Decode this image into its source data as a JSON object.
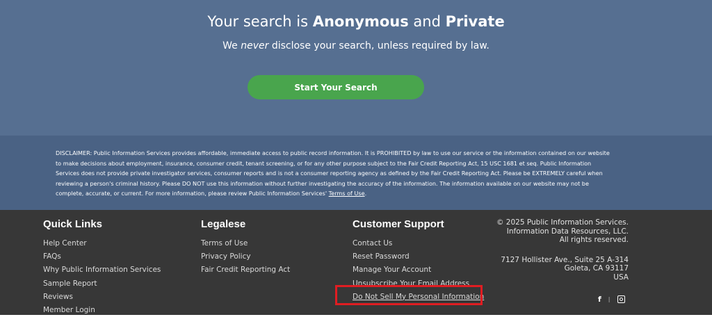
{
  "hero": {
    "title_prefix": "Your search is ",
    "title_bold1": "Anonymous",
    "title_mid": " and ",
    "title_bold2": "Private",
    "sub_prefix": "We ",
    "sub_em": "never",
    "sub_suffix": " disclose your search, unless required by law.",
    "cta_label": "Start Your Search"
  },
  "disclaimer": {
    "text": "DISCLAIMER: Public Information Services provides affordable, immediate access to public record information. It is PROHIBITED by law to use our service or the information contained on our website to make decisions about employment, insurance, consumer credit, tenant screening, or for any other purpose subject to the Fair Credit Reporting Act, 15 USC 1681 et seq. Public Information Services does not provide private investigator services, consumer reports and is not a consumer reporting agency as defined by the Fair Credit Reporting Act. Please be EXTREMELY careful when reviewing a person's criminal history. Please DO NOT use this information without further investigating the accuracy of the information. The information available on our website may not be complete, accurate, or current. For more information, please review Public Information Services'",
    "link": "Terms of Use",
    "end": "."
  },
  "footer": {
    "quick_links": {
      "title": "Quick Links",
      "items": [
        "Help Center",
        "FAQs",
        "Why Public Information Services",
        "Sample Report",
        "Reviews",
        "Member Login"
      ]
    },
    "legalese": {
      "title": "Legalese",
      "items": [
        "Terms of Use",
        "Privacy Policy",
        "Fair Credit Reporting Act"
      ]
    },
    "support": {
      "title": "Customer Support",
      "items": [
        "Contact Us",
        "Reset Password",
        "Manage Your Account",
        "Unsubscribe Your Email Address",
        "Do Not Sell My Personal Information"
      ]
    },
    "company": {
      "line1": "© 2025 Public Information Services.",
      "line2": "Information Data Resources, LLC.",
      "line3": "All rights reserved.",
      "addr1": "7127 Hollister Ave., Suite 25 A-314",
      "addr2": "Goleta, CA 93117",
      "addr3": "USA"
    },
    "social": {
      "facebook_glyph": "f",
      "separator": "|"
    }
  },
  "colors": {
    "hero_bg": "#566f91",
    "disclaimer_bg": "#4a6284",
    "footer_bg": "#373737",
    "cta_bg": "#49a54d",
    "highlight_border": "#e01d22"
  }
}
